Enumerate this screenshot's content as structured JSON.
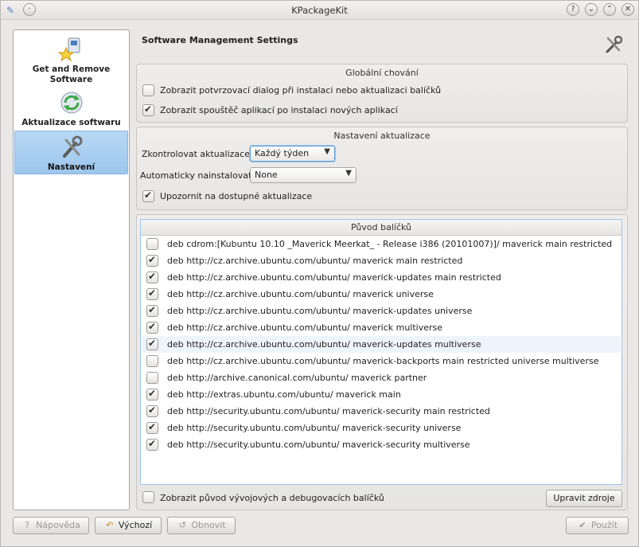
{
  "window": {
    "title": "KPackageKit"
  },
  "sidebar": {
    "items": [
      {
        "label": "Get and Remove Software",
        "icon": "package-star-icon"
      },
      {
        "label": "Aktualizace softwaru",
        "icon": "update-arrows-icon"
      },
      {
        "label": "Nastavení",
        "icon": "tools-icon",
        "selected": true
      }
    ]
  },
  "main": {
    "title": "Software Management Settings",
    "global": {
      "title": "Globální chování",
      "options": [
        {
          "label": "Zobrazit potvrzovací dialog při instalaci nebo aktualizaci balíčků",
          "checked": false
        },
        {
          "label": "Zobrazit spouštěč aplikací po instalaci nových aplikací",
          "checked": true
        }
      ]
    },
    "updates": {
      "title": "Nastavení aktualizace",
      "check_label": "Zkontrolovat aktualizace:",
      "check_value": "Každý týden",
      "install_label": "Automaticky nainstalovat:",
      "install_value": "None",
      "notify_label": "Upozornit na dostupné aktualizace",
      "notify_checked": true
    },
    "sources": {
      "title": "Původ balíčků",
      "rows": [
        {
          "text": "deb  cdrom:[Kubuntu 10.10 _Maverick Meerkat_ - Release i386 (20101007)]/ maverick main restricted",
          "checked": false
        },
        {
          "text": "deb  http://cz.archive.ubuntu.com/ubuntu/ maverick main restricted",
          "checked": true
        },
        {
          "text": "deb  http://cz.archive.ubuntu.com/ubuntu/ maverick-updates main restricted",
          "checked": true
        },
        {
          "text": "deb  http://cz.archive.ubuntu.com/ubuntu/ maverick universe",
          "checked": true
        },
        {
          "text": "deb  http://cz.archive.ubuntu.com/ubuntu/ maverick-updates universe",
          "checked": true
        },
        {
          "text": "deb  http://cz.archive.ubuntu.com/ubuntu/ maverick multiverse",
          "checked": true
        },
        {
          "text": "deb  http://cz.archive.ubuntu.com/ubuntu/ maverick-updates multiverse",
          "checked": true,
          "highlighted": true
        },
        {
          "text": "deb  http://cz.archive.ubuntu.com/ubuntu/ maverick-backports main restricted universe multiverse",
          "checked": false
        },
        {
          "text": "deb  http://archive.canonical.com/ubuntu/ maverick partner",
          "checked": false
        },
        {
          "text": "deb  http://extras.ubuntu.com/ubuntu/ maverick main",
          "checked": true
        },
        {
          "text": "deb  http://security.ubuntu.com/ubuntu/ maverick-security main restricted",
          "checked": true
        },
        {
          "text": "deb  http://security.ubuntu.com/ubuntu/ maverick-security universe",
          "checked": true
        },
        {
          "text": "deb  http://security.ubuntu.com/ubuntu/ maverick-security multiverse",
          "checked": true
        }
      ],
      "show_debug_label": "Zobrazit původ vývojových a debugovacích balíčků",
      "show_debug_checked": false,
      "edit_button": "Upravit zdroje"
    }
  },
  "buttons": {
    "help": "Nápověda",
    "defaults": "Výchozí",
    "reset": "Obnovit",
    "apply": "Použít"
  }
}
